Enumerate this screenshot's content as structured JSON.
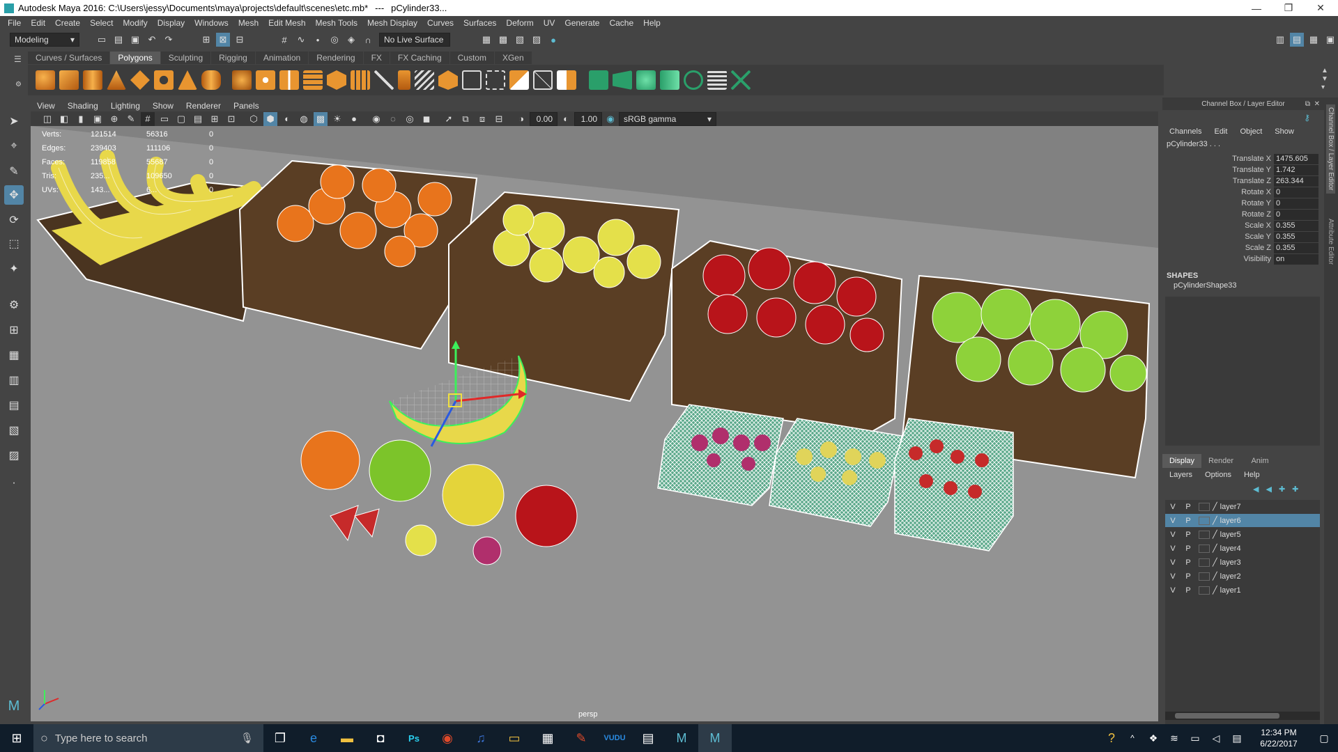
{
  "window": {
    "title": "Autodesk Maya 2016: C:\\Users\\jessy\\Documents\\maya\\projects\\default\\scenes\\etc.mb*",
    "separator": "---",
    "object": "pCylinder33...",
    "minimize": "—",
    "maximize": "❐",
    "close": "✕"
  },
  "menubar": [
    "File",
    "Edit",
    "Create",
    "Select",
    "Modify",
    "Display",
    "Windows",
    "Mesh",
    "Edit Mesh",
    "Mesh Tools",
    "Mesh Display",
    "Curves",
    "Surfaces",
    "Deform",
    "UV",
    "Generate",
    "Cache",
    "Help"
  ],
  "statusline": {
    "mode": "Modeling",
    "live_surface": "No Live Surface"
  },
  "shelf_tabs": [
    "Curves / Surfaces",
    "Polygons",
    "Sculpting",
    "Rigging",
    "Animation",
    "Rendering",
    "FX",
    "FX Caching",
    "Custom",
    "XGen"
  ],
  "shelf_active": "Polygons",
  "viewport_menu": [
    "View",
    "Shading",
    "Lighting",
    "Show",
    "Renderer",
    "Panels"
  ],
  "viewport_bar": {
    "exposure": "0.00",
    "gamma": "1.00",
    "colorspace": "sRGB gamma"
  },
  "hud": [
    {
      "label": "Verts:",
      "v1": "121514",
      "v2": "56316",
      "v3": "0"
    },
    {
      "label": "Edges:",
      "v1": "239403",
      "v2": "111106",
      "v3": "0"
    },
    {
      "label": "Faces:",
      "v1": "119858",
      "v2": "55687",
      "v3": "0"
    },
    {
      "label": "Tris:",
      "v1": "235...",
      "v2": "109650",
      "v3": "0"
    },
    {
      "label": "UVs:",
      "v1": "143...",
      "v2": "6...",
      "v3": "0"
    }
  ],
  "viewport_camera": "persp",
  "channel_box": {
    "title": "Channel Box / Layer Editor",
    "menu": [
      "Channels",
      "Edit",
      "Object",
      "Show"
    ],
    "object": "pCylinder33 . . .",
    "attributes": [
      {
        "name": "Translate X",
        "value": "1475.605"
      },
      {
        "name": "Translate Y",
        "value": "1.742"
      },
      {
        "name": "Translate Z",
        "value": "263.344"
      },
      {
        "name": "Rotate X",
        "value": "0"
      },
      {
        "name": "Rotate Y",
        "value": "0"
      },
      {
        "name": "Rotate Z",
        "value": "0"
      },
      {
        "name": "Scale X",
        "value": "0.355"
      },
      {
        "name": "Scale Y",
        "value": "0.355"
      },
      {
        "name": "Scale Z",
        "value": "0.355"
      },
      {
        "name": "Visibility",
        "value": "on"
      }
    ],
    "shapes_label": "SHAPES",
    "shape_name": "pCylinderShape33"
  },
  "layer_editor": {
    "tabs": [
      "Display",
      "Render",
      "Anim"
    ],
    "active_tab": "Display",
    "menu": [
      "Layers",
      "Options",
      "Help"
    ],
    "layers": [
      {
        "v": "V",
        "p": "P",
        "name": "layer7",
        "selected": false
      },
      {
        "v": "V",
        "p": "P",
        "name": "layer6",
        "selected": true
      },
      {
        "v": "V",
        "p": "P",
        "name": "layer5",
        "selected": false
      },
      {
        "v": "V",
        "p": "P",
        "name": "layer4",
        "selected": false
      },
      {
        "v": "V",
        "p": "P",
        "name": "layer3",
        "selected": false
      },
      {
        "v": "V",
        "p": "P",
        "name": "layer2",
        "selected": false
      },
      {
        "v": "V",
        "p": "P",
        "name": "layer1",
        "selected": false
      }
    ]
  },
  "side_tabs": [
    "Channel Box / Layer Editor",
    "Attribute Editor"
  ],
  "taskbar": {
    "search_placeholder": "Type here to search",
    "time": "12:34 PM",
    "date": "6/22/2017"
  },
  "colors": {
    "selection": "#5285a6",
    "viewport_bg": "#8f8f8f",
    "panel_bg": "#444444",
    "accent": "#5dbcd2"
  }
}
